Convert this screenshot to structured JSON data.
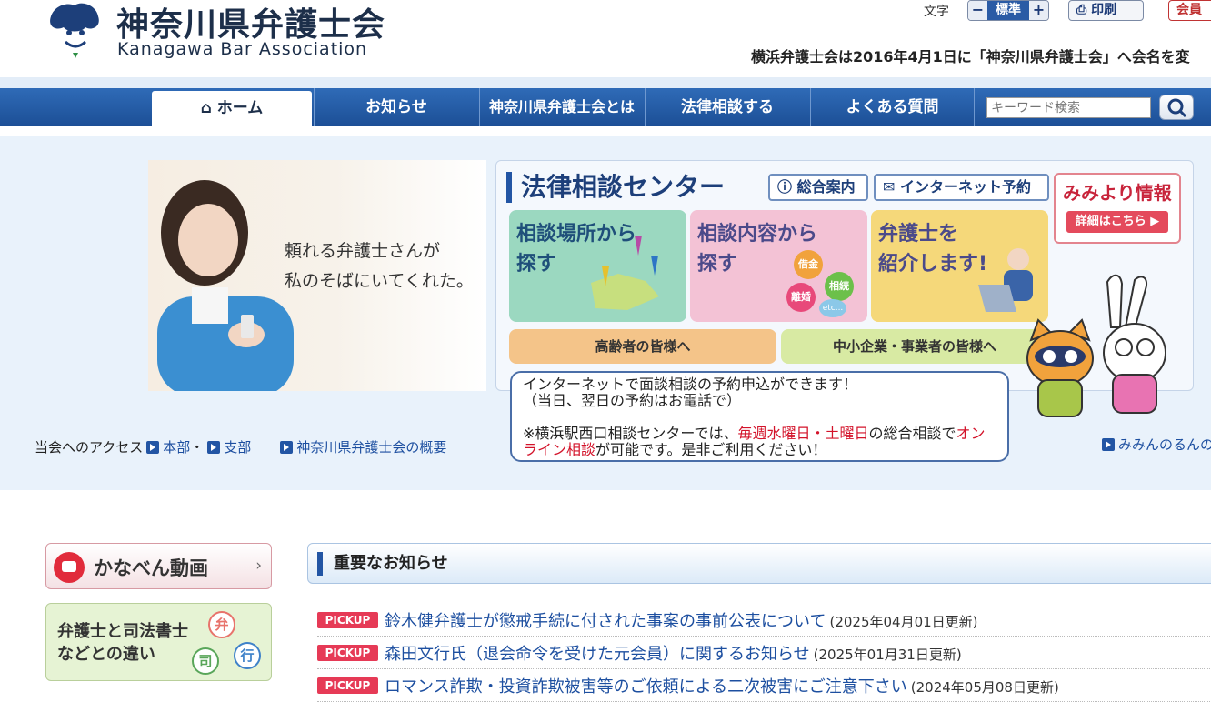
{
  "header": {
    "logo_jp": "神奈川県弁護士会",
    "logo_en": "Kanagawa Bar Association",
    "font_label": "文字",
    "font_minus": "−",
    "font_standard": "標準",
    "font_plus": "+",
    "print_label": "印刷",
    "member_label": "会員",
    "rename_notice": "横浜弁護士会は2016年4月1日に「神奈川県弁護士会」へ会名を変"
  },
  "nav": {
    "items": [
      "ホーム",
      "お知らせ",
      "神奈川県弁護士会とは",
      "法律相談する",
      "よくある質問"
    ],
    "search_placeholder": "キーワード検索"
  },
  "hero": {
    "photo_line1": "頼れる弁護士さんが",
    "photo_line2": "私のそばにいてくれた。",
    "center_title": "法律相談センター",
    "pill_info": "総合案内",
    "pill_reserve": "インターネット予約",
    "info_title": "みみより情報",
    "info_button": "詳細はこちら ▶",
    "tiles": [
      {
        "line1": "相談場所から",
        "line2": "探す"
      },
      {
        "line1": "相談内容から",
        "line2": "探す"
      },
      {
        "line1": "弁護士を",
        "line2": "紹介します!"
      }
    ],
    "tile_tags": [
      "借金",
      "相続",
      "離婚",
      "etc..."
    ],
    "bar_elderly": "高齢者の皆様へ",
    "bar_business": "中小企業・事業者の皆様へ",
    "bubble_line1": "インターネットで面談相談の予約申込ができます！",
    "bubble_line2": "（当日、翌日の予約はお電話で）",
    "bubble_p1": "※横浜駅西口相談センターでは、",
    "bubble_red1": "毎週水曜日・土曜日",
    "bubble_p2": "の総合相談で",
    "bubble_red2": "オンライン相談",
    "bubble_p3": "が可能です。是非ご利用ください！"
  },
  "access": {
    "label": "当会へのアクセス",
    "honbu": "本部",
    "dot": "・",
    "shibu": "支部",
    "overview": "神奈川県弁護士会の概要",
    "mimin": "みみんのるんの"
  },
  "side": {
    "video": "かなべん動画",
    "diff_line1": "弁護士と司法書士",
    "diff_line2": "などとの違い",
    "diff_marks": [
      "弁",
      "司",
      "行"
    ]
  },
  "notices": {
    "title": "重要なお知らせ",
    "badge": "PICKUP",
    "items": [
      {
        "title": "鈴木健弁護士が懲戒手続に付された事案の事前公表について",
        "date": "(2025年04月01日更新)"
      },
      {
        "title": "森田文行氏（退会命令を受けた元会員）に関するお知らせ",
        "date": "(2025年01月31日更新)"
      },
      {
        "title": "ロマンス詐欺・投資詐欺被害等のご依頼による二次被害にご注意下さい",
        "date": "(2024年05月08日更新)"
      }
    ]
  },
  "colors": {
    "nav": "#1c4f96",
    "hero_bg": "#e9f2fb",
    "accent_red": "#d3132a",
    "pickup": "#e63a56"
  }
}
